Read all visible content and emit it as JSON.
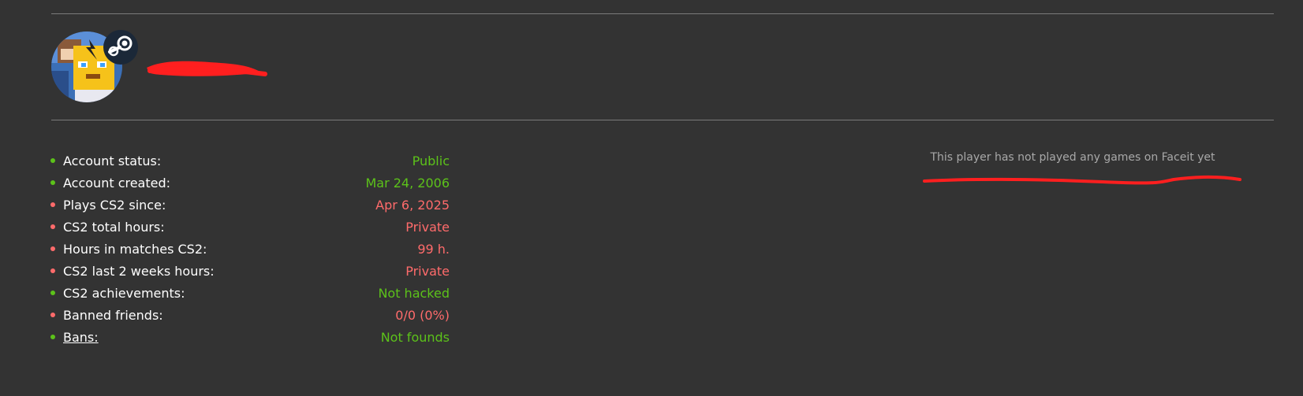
{
  "profile": {
    "avatar_icon": "avatar-image",
    "platform_icon": "steam-icon"
  },
  "colors": {
    "ok": "#5cc21a",
    "bad": "#ff6b6b",
    "background": "#333333",
    "redaction": "#ff1f1f"
  },
  "stats": [
    {
      "label": "Account status:",
      "value": "Public",
      "status": "ok"
    },
    {
      "label": "Account created:",
      "value": "Mar 24, 2006",
      "status": "ok"
    },
    {
      "label": "Plays CS2 since:",
      "value": "Apr 6, 2025",
      "status": "bad"
    },
    {
      "label": "CS2 total hours:",
      "value": "Private",
      "status": "bad"
    },
    {
      "label": "Hours in matches CS2:",
      "value": "99 h.",
      "status": "bad"
    },
    {
      "label": "CS2 last 2 weeks hours:",
      "value": "Private",
      "status": "bad"
    },
    {
      "label": "CS2 achievements:",
      "value": "Not hacked",
      "status": "ok"
    },
    {
      "label": "Banned friends:",
      "value": "0/0 (0%)",
      "status": "bad"
    },
    {
      "label": "Bans:",
      "value": "Not founds",
      "status": "ok"
    }
  ],
  "faceit": {
    "message": "This player has not played any games on Faceit yet"
  }
}
